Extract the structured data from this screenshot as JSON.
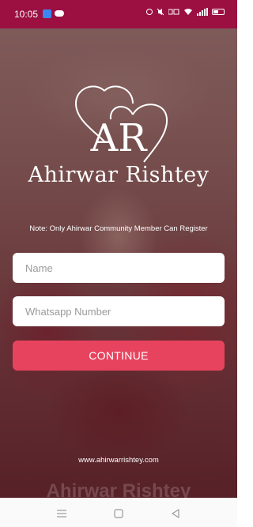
{
  "status_bar": {
    "time": "10:05",
    "icons": [
      "app-notification-icon",
      "cloud-icon",
      "alarm-icon",
      "mute-icon",
      "data-speed-icon",
      "wifi-icon",
      "signal-icon",
      "battery-icon"
    ]
  },
  "brand": {
    "monogram": "AR",
    "name": "Ahirwar Rishtey"
  },
  "note": "Note: Only Ahirwar Community Member Can Register",
  "form": {
    "name_placeholder": "Name",
    "name_value": "",
    "whatsapp_placeholder": "Whatsapp Number",
    "whatsapp_value": "",
    "continue_label": "CONTINUE"
  },
  "footer": {
    "website": "www.ahirwarrishtey.com",
    "watermark": "Ahirwar Rishtey"
  },
  "nav_bar": {
    "buttons": [
      "menu-icon",
      "home-icon",
      "back-icon"
    ]
  },
  "colors": {
    "status_bar": "#9b1041",
    "button": "#e8435e",
    "text_light": "#ffffff"
  }
}
